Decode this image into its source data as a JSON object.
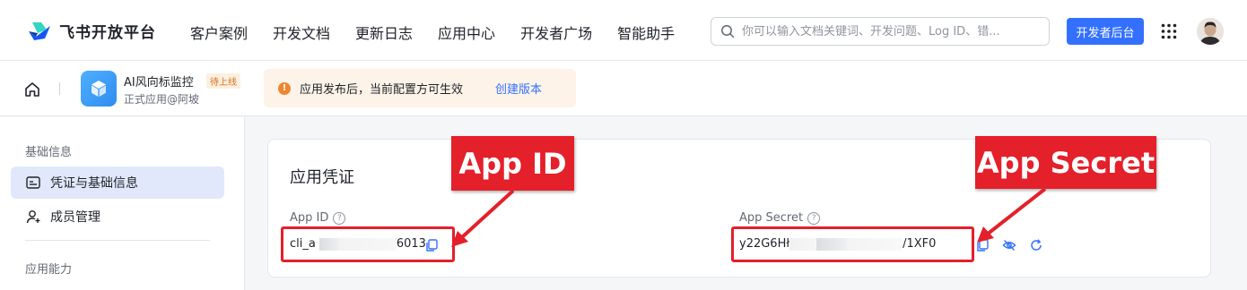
{
  "brand": {
    "name": "飞书开放平台"
  },
  "nav": {
    "items": [
      "客户案例",
      "开发文档",
      "更新日志",
      "应用中心",
      "开发者广场",
      "智能助手"
    ]
  },
  "search": {
    "placeholder": "你可以输入文档关键词、开发问题、Log ID、错..."
  },
  "dev_console_button": "开发者后台",
  "app": {
    "name": "AI风向标监控",
    "status_badge": "待上线",
    "owner": "正式应用@阿坡"
  },
  "notice": {
    "icon_text": "!",
    "text": "应用发布后，当前配置方可生效",
    "link": "创建版本"
  },
  "sidebar": {
    "group1": "基础信息",
    "items": [
      {
        "label": "凭证与基础信息",
        "icon": "credential-icon",
        "active": true
      },
      {
        "label": "成员管理",
        "icon": "add-member-icon",
        "active": false
      }
    ],
    "group2": "应用能力"
  },
  "credentials": {
    "title": "应用凭证",
    "app_id": {
      "label": "App ID",
      "help": "?",
      "value_prefix": "cli_a",
      "value_suffix": "6013"
    },
    "app_secret": {
      "label": "App Secret",
      "help": "?",
      "value_prefix": "y22G6Hł",
      "value_suffix": "/1XF0"
    }
  },
  "annotations": {
    "app_id": "App ID",
    "app_secret": "App Secret",
    "color": "#e4202a"
  },
  "colors": {
    "accent": "#3370ff",
    "active_bg": "#e1e8fb",
    "notice_bg": "#fdf3e8"
  }
}
